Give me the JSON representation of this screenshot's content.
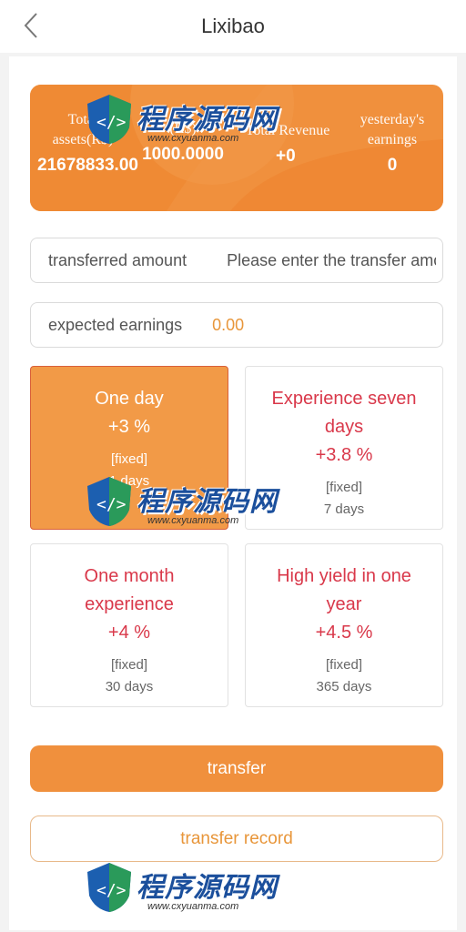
{
  "header": {
    "title": "Lixibao",
    "back_icon": "chevron-left-icon"
  },
  "summary": {
    "total_assets_label": "Total assets(R$)",
    "total_assets_value": "21678833.00",
    "balance_label": "(R$)",
    "balance_value": "1000.0000",
    "total_revenue_label": "Total Revenue",
    "total_revenue_value": "+0",
    "yesterday_label": "yesterday's earnings",
    "yesterday_value": "0",
    "bg_color": "#f0903d"
  },
  "transfer_field": {
    "label": "transferred amount",
    "placeholder": "Please enter the transfer amount"
  },
  "earnings_field": {
    "label": "expected earnings",
    "value": "0.00"
  },
  "plans": [
    {
      "name": "One day",
      "rate": "+3 %",
      "type": "[fixed]",
      "days": "1 days",
      "active": true
    },
    {
      "name": "Experience seven days",
      "rate": "+3.8 %",
      "type": "[fixed]",
      "days": "7 days",
      "active": false
    },
    {
      "name": "One month experience",
      "rate": "+4 %",
      "type": "[fixed]",
      "days": "30 days",
      "active": false
    },
    {
      "name": "High yield in one year",
      "rate": "+4.5 %",
      "type": "[fixed]",
      "days": "365 days",
      "active": false
    }
  ],
  "actions": {
    "transfer": "transfer",
    "record": "transfer record"
  },
  "watermark": {
    "text": "程序源码网",
    "url": "www.cxyuanma.com"
  },
  "colors": {
    "accent": "#f0903d",
    "plan_text": "#d9384a",
    "earn_value": "#e8963a"
  }
}
